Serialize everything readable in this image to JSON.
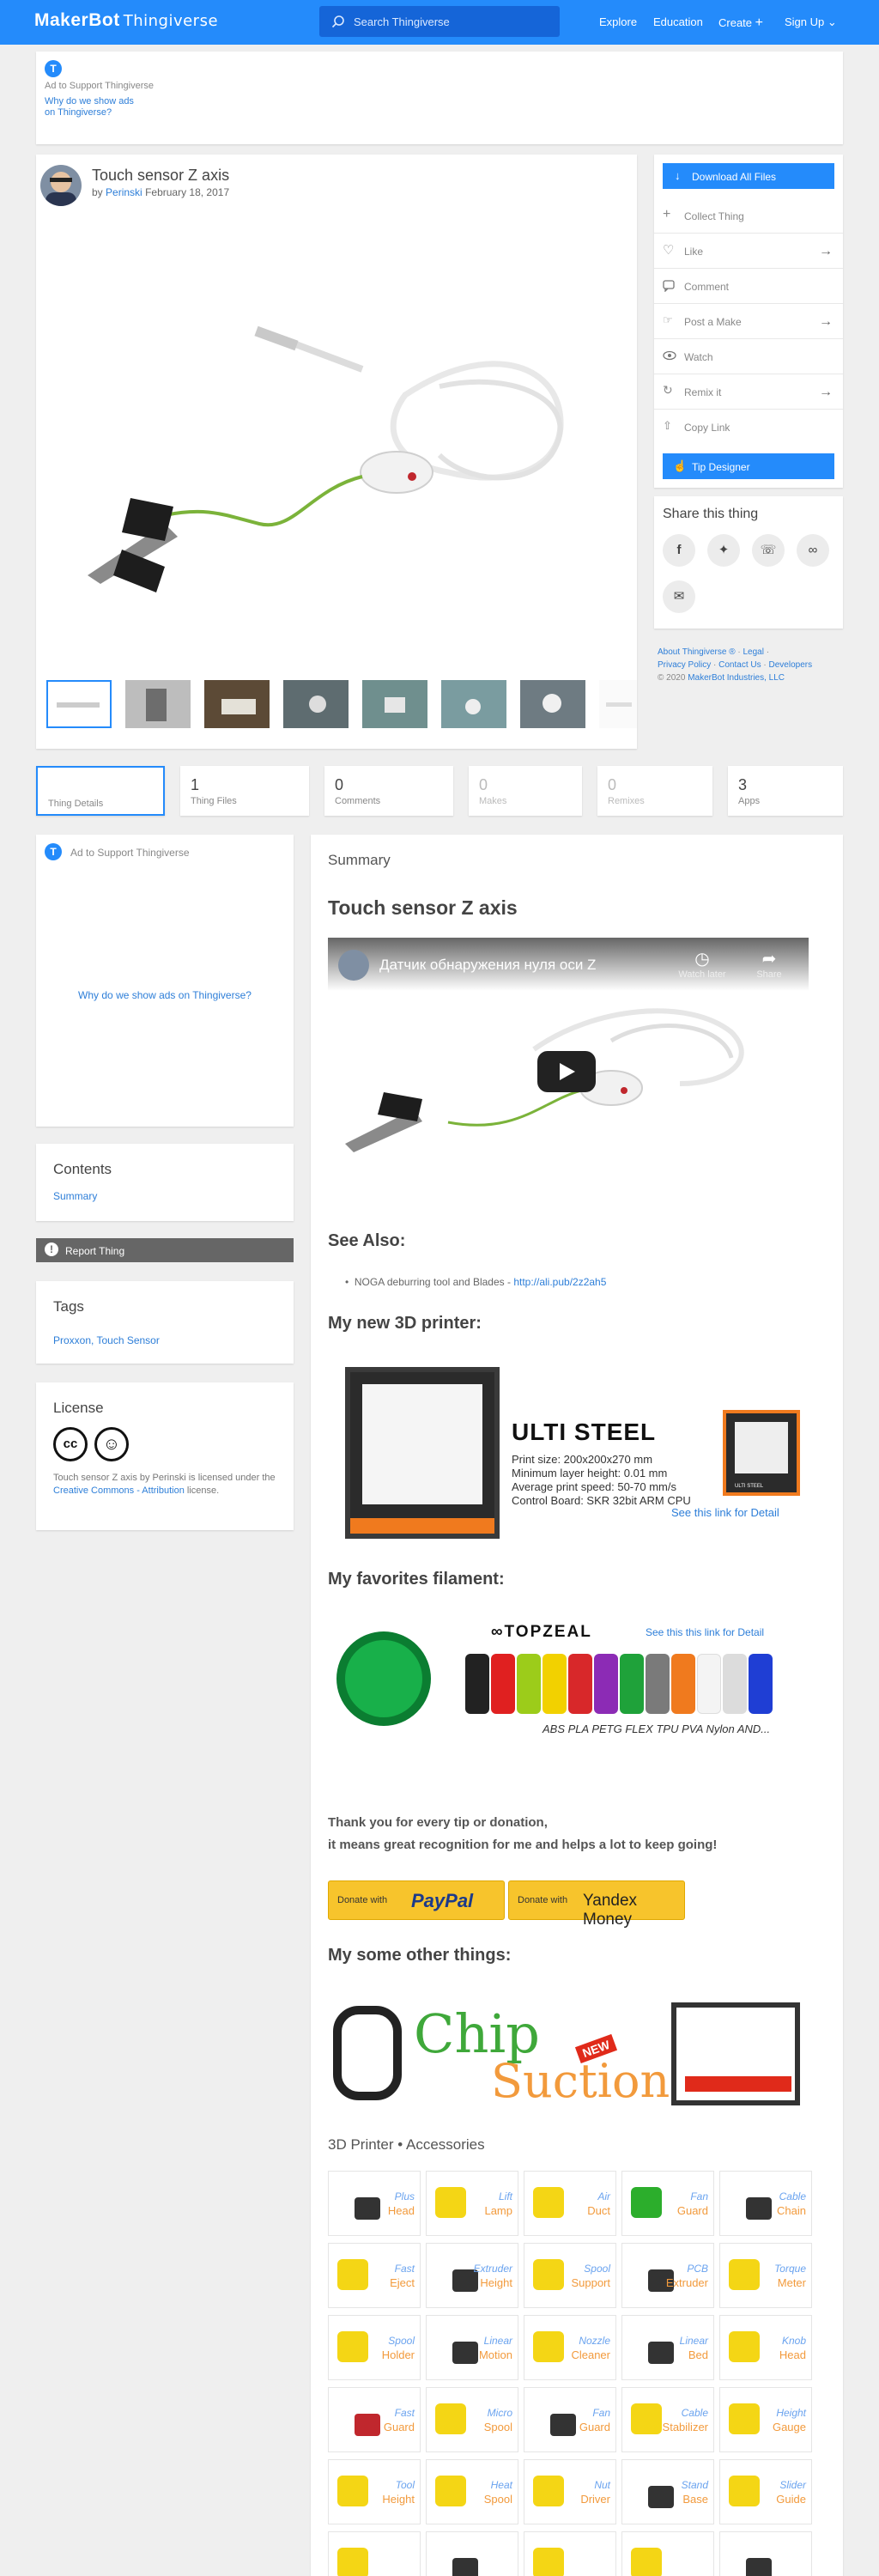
{
  "header": {
    "logo_brand": "MakerBot",
    "logo_product": "Thingiverse",
    "search_placeholder": "Search Thingiverse",
    "nav": [
      "Explore",
      "Education",
      "Create",
      "Sign Up"
    ]
  },
  "top_ad": {
    "label": "Ad to Support Thingiverse",
    "why1": "Why do we show ads",
    "why2": "on Thingiverse?"
  },
  "thing": {
    "title": "Touch sensor Z axis",
    "by": "by",
    "author": "Perinski",
    "date": "February 18, 2017"
  },
  "actions": {
    "download": "Download All Files",
    "collect": "Collect Thing",
    "like": "Like",
    "comment": "Comment",
    "post_make": "Post a Make",
    "watch": "Watch",
    "remix": "Remix it",
    "copy_link": "Copy Link",
    "tip": "Tip Designer"
  },
  "share": {
    "title": "Share this thing"
  },
  "footer_links": {
    "about": "About Thingiverse ®",
    "legal": "Legal",
    "privacy": "Privacy Policy",
    "contact": "Contact Us",
    "developers": "Developers",
    "copyright_pre": "©  2020",
    "company": "MakerBot Industries, LLC"
  },
  "tabs": [
    {
      "count": "",
      "label": "Thing Details"
    },
    {
      "count": "1",
      "label": "Thing Files"
    },
    {
      "count": "0",
      "label": "Comments"
    },
    {
      "count": "0",
      "label": "Makes"
    },
    {
      "count": "0",
      "label": "Remixes"
    },
    {
      "count": "3",
      "label": "Apps"
    }
  ],
  "side_ad": {
    "label": "Ad to Support Thingiverse",
    "why": "Why do we show ads on Thingiverse?"
  },
  "contents": {
    "title": "Contents",
    "item": "Summary"
  },
  "report": "Report Thing",
  "tags": {
    "title": "Tags",
    "list": "Proxxon, Touch Sensor"
  },
  "license": {
    "title": "License",
    "text1": "Touch sensor Z axis by Perinski is licensed under the",
    "link": "Creative Commons - Attribution",
    "text2": "license."
  },
  "summary": {
    "heading": "Summary",
    "title": "Touch sensor Z axis",
    "video_title": "Датчик обнаружения нуля оси Z",
    "video_watch_later": "Watch later",
    "video_share": "Share",
    "see_also": "See Also:",
    "see_also_item": "NOGA deburring tool and Blades - ",
    "see_also_link": "http://ali.pub/2z2ah5",
    "printer_heading": "My new 3D printer:",
    "printer": {
      "brand": "ULTI STEEL",
      "specs": [
        "Print size: 200x200x270 mm",
        "Minimum layer height: 0.01 mm",
        "Average print speed: 50-70 mm/s",
        "Control Board: SKR 32bit ARM CPU"
      ],
      "link": "See this link for Detail",
      "label": "ULTI STEEL"
    },
    "filament_heading": "My favorites filament:",
    "filament": {
      "brand": "TOPZEAL",
      "link": "See this this link for Detail",
      "types": "ABS PLA PETG FLEX TPU PVA Nylon AND..."
    },
    "thanks1": "Thank you for every tip or donation,",
    "thanks2": "it means great recognition for me and helps a lot to keep going!",
    "donate_pre": "Donate with",
    "paypal": "PayPal",
    "yandex": "Yandex Money",
    "other_heading": "My some other things:",
    "banner_chip": "Chip",
    "banner_suction": "Suction",
    "banner_new": "NEW",
    "accessories": "3D Printer • Accessories",
    "tiles": [
      [
        "Plus",
        "Head"
      ],
      [
        "Lift",
        "Lamp"
      ],
      [
        "Air",
        "Duct"
      ],
      [
        "Fan",
        "Guard"
      ],
      [
        "Cable",
        "Chain"
      ],
      [
        "Fast",
        "Eject"
      ],
      [
        "Extruder",
        "Height"
      ],
      [
        "Spool",
        "Support"
      ],
      [
        "PCB",
        "Extruder"
      ],
      [
        "Torque",
        "Meter"
      ],
      [
        "Spool",
        "Holder"
      ],
      [
        "Linear",
        "Motion"
      ],
      [
        "Nozzle",
        "Cleaner"
      ],
      [
        "Linear",
        "Bed"
      ],
      [
        "Knob",
        "Head"
      ],
      [
        "Fast",
        "Guard"
      ],
      [
        "Micro",
        "Spool"
      ],
      [
        "Fan",
        "Guard"
      ],
      [
        "Cable",
        "Stabilizer"
      ],
      [
        "Height",
        "Gauge"
      ],
      [
        "Tool",
        "Height"
      ],
      [
        "Heat",
        "Spool"
      ],
      [
        "Nut",
        "Driver"
      ],
      [
        "Stand",
        "Base"
      ],
      [
        "Slider",
        "Guide"
      ]
    ]
  }
}
